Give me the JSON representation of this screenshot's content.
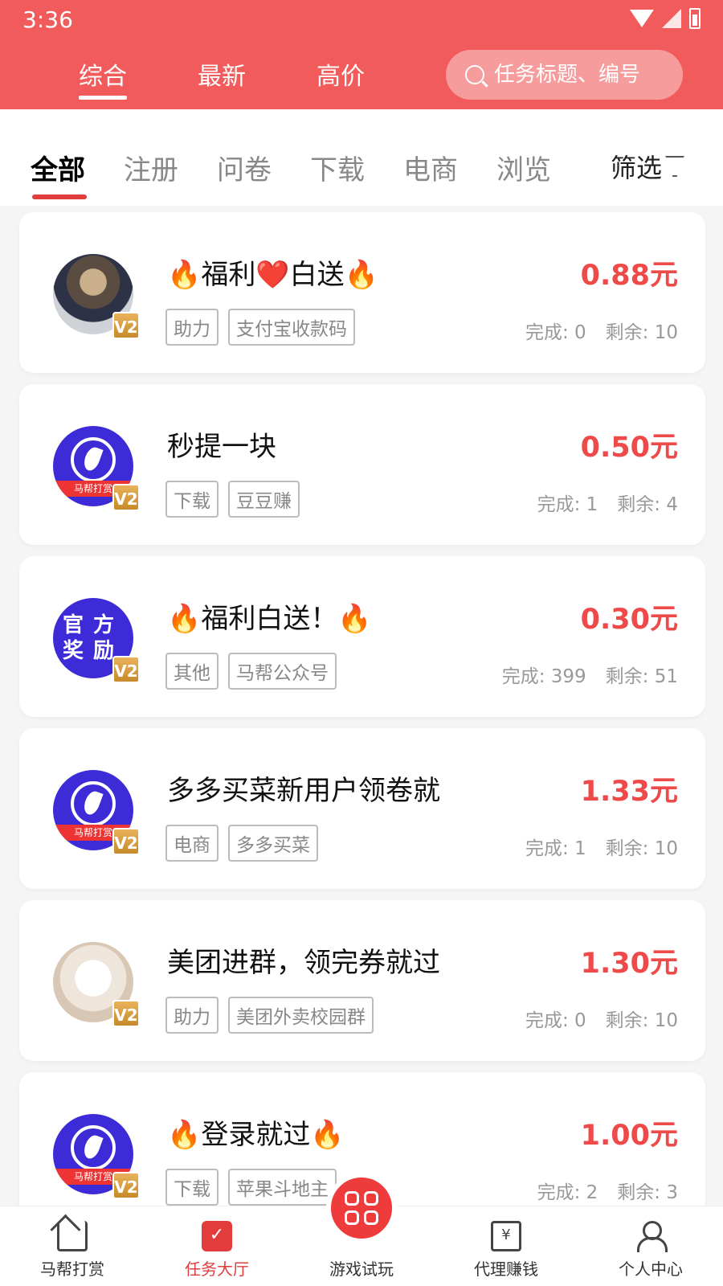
{
  "status": {
    "time": "3:36"
  },
  "header": {
    "tabs": [
      {
        "label": "综合",
        "active": true
      },
      {
        "label": "最新",
        "active": false
      },
      {
        "label": "高价",
        "active": false
      }
    ],
    "search_placeholder": "任务标题、编号"
  },
  "categories": {
    "items": [
      "全部",
      "注册",
      "问卷",
      "下载",
      "电商",
      "浏览"
    ],
    "active_index": 0,
    "filter_label": "筛选"
  },
  "tasks": [
    {
      "title_prefix": "🔥",
      "title": "福利❤️白送",
      "title_suffix": "🔥",
      "price": "0.88元",
      "tags": [
        "助力",
        "支付宝收款码"
      ],
      "done": "完成: 0",
      "left": "剩余: 10",
      "avatar": "cat-photo"
    },
    {
      "title_prefix": "",
      "title": "秒提一块",
      "title_suffix": "",
      "price": "0.50元",
      "tags": [
        "下载",
        "豆豆赚"
      ],
      "done": "完成: 1",
      "left": "剩余: 4",
      "avatar": "brand"
    },
    {
      "title_prefix": "🔥",
      "title": "福利白送！",
      "title_suffix": "🔥",
      "price": "0.30元",
      "tags": [
        "其他",
        "马帮公众号"
      ],
      "done": "完成: 399",
      "left": "剩余: 51",
      "avatar": "official"
    },
    {
      "title_prefix": "",
      "title": "多多买菜新用户领卷就",
      "title_suffix": "",
      "price": "1.33元",
      "tags": [
        "电商",
        "多多买菜"
      ],
      "done": "完成: 1",
      "left": "剩余: 10",
      "avatar": "brand"
    },
    {
      "title_prefix": "",
      "title": "美团进群，领完券就过",
      "title_suffix": "",
      "price": "1.30元",
      "tags": [
        "助力",
        "美团外卖校园群"
      ],
      "done": "完成: 0",
      "left": "剩余: 10",
      "avatar": "dog-photo"
    },
    {
      "title_prefix": "🔥",
      "title": "登录就过",
      "title_suffix": "🔥",
      "price": "1.00元",
      "tags": [
        "下载",
        "苹果斗地主"
      ],
      "done": "完成: 2",
      "left": "剩余: 3",
      "avatar": "brand"
    }
  ],
  "avatar_text": {
    "brand_ribbon": "马帮打赏",
    "official": "官方奖励",
    "vip": "V2"
  },
  "bottom_nav": [
    {
      "label": "马帮打赏",
      "icon": "home-icon"
    },
    {
      "label": "任务大厅",
      "icon": "task-bag-icon",
      "active": true
    },
    {
      "label": "游戏试玩",
      "icon": "game-grid-icon"
    },
    {
      "label": "代理赚钱",
      "icon": "mail-money-icon"
    },
    {
      "label": "个人中心",
      "icon": "user-icon"
    }
  ],
  "colors": {
    "header": "#f25b5b",
    "accent": "#ee4a4a",
    "brand_avatar": "#3c2bd6"
  }
}
